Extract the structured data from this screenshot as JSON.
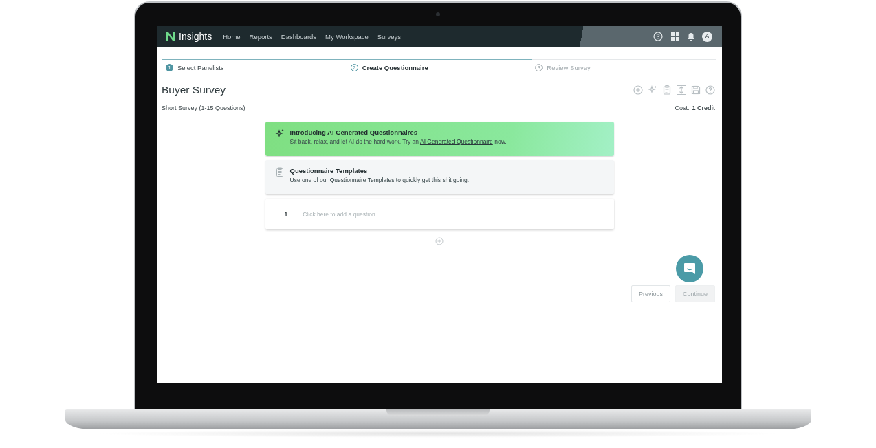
{
  "nav": {
    "brand": "Insights",
    "items": [
      "Home",
      "Reports",
      "Dashboards",
      "My Workspace",
      "Surveys"
    ],
    "avatar": "A"
  },
  "stepper": {
    "level": 0.667,
    "steps": [
      {
        "number": "1",
        "label": "Select Panelists",
        "completed": true,
        "selected": false
      },
      {
        "number": "2",
        "label": "Create Questionnaire",
        "completed": false,
        "selected": true
      },
      {
        "number": "3",
        "label": "Review Survey",
        "completed": false,
        "selected": false
      }
    ]
  },
  "survey": {
    "title": "Buyer Survey",
    "subtitle": "Short Survey (1-15 Questions)",
    "cost_label": "Cost:",
    "cost_value": "1 Credit"
  },
  "banners": [
    {
      "kind": "ai",
      "title": "Introducing AI Generated Questionnaires",
      "text_before": "Sit back, relax, and let AI do the hard work. Try an ",
      "link": "AI Generated Questionnaire",
      "text_after": " now."
    },
    {
      "kind": "templates",
      "title": "Questionnaire Templates",
      "text_before": "Use one of our ",
      "link": "Questionnaire Templates",
      "text_after": " to quickly get this shit going."
    }
  ],
  "questions": [
    {
      "number": "1",
      "placeholder": "Click here to add a question"
    }
  ],
  "buttons": [
    {
      "label": "Previous",
      "disabled": false
    },
    {
      "label": "Continue",
      "disabled": true
    }
  ]
}
